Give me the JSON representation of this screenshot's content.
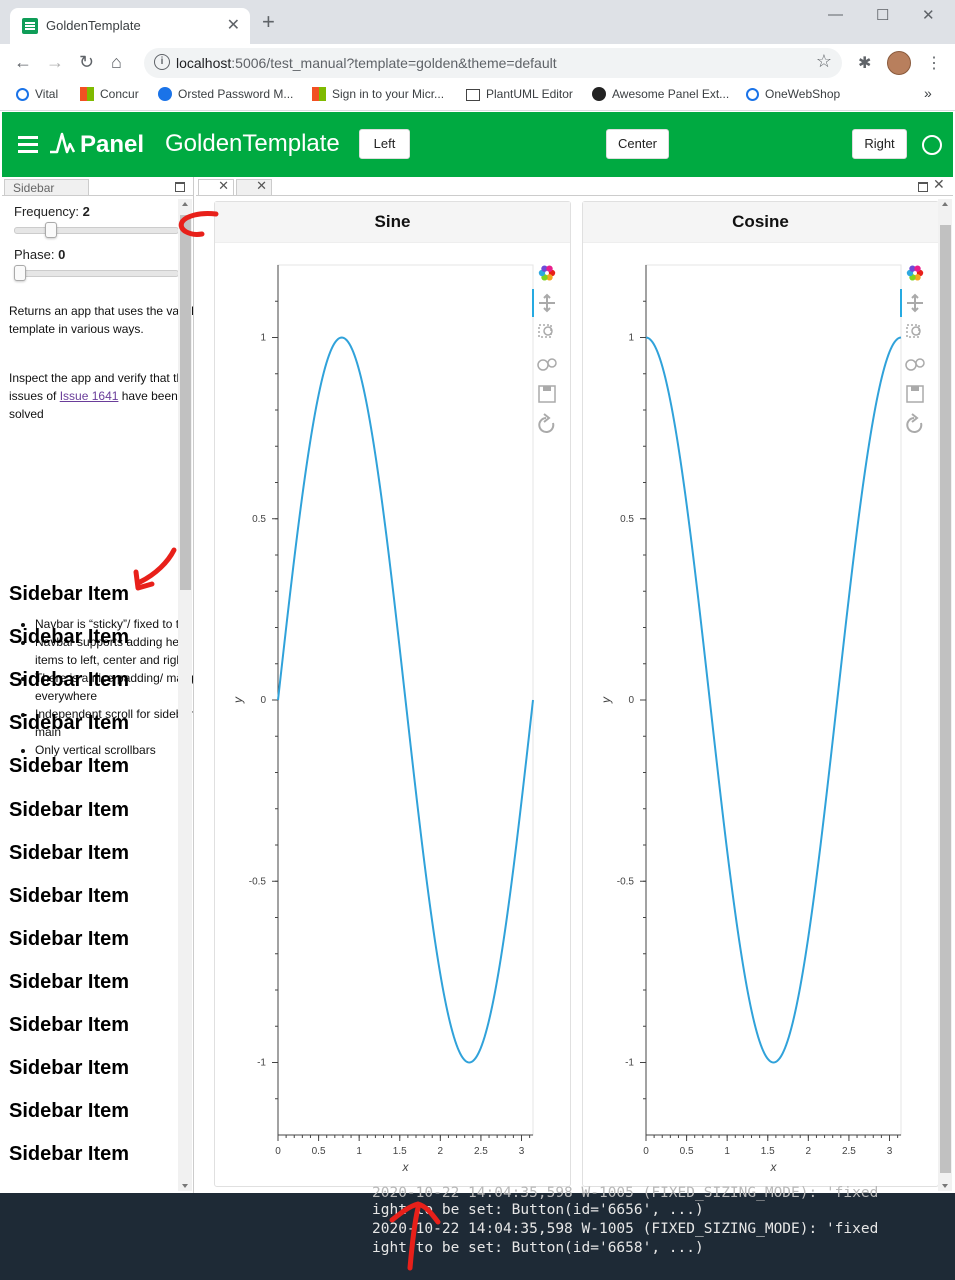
{
  "browser": {
    "tab_title": "GoldenTemplate",
    "url_host": "localhost",
    "url_rest": ":5006/test_manual?template=golden&theme=default",
    "bookmarks": [
      "Vital",
      "Concur",
      "Orsted Password M...",
      "Sign in to your Micr...",
      "PlantUML Editor",
      "Awesome Panel Ext...",
      "OneWebShop"
    ],
    "bookmarks_more": "»"
  },
  "header": {
    "logo": "Panel",
    "title": "GoldenTemplate",
    "left_label": "Left",
    "center_label": "Center",
    "right_label": "Right"
  },
  "sidebar": {
    "tab_label": "Sidebar",
    "frequency_label": "Frequency:",
    "frequency_value": "2",
    "frequency_fraction": 0.2,
    "phase_label": "Phase:",
    "phase_value": "0",
    "phase_fraction": 0.0,
    "desc1": "Returns an app that uses the vanilla template in various ways.",
    "desc2_pre": "Inspect the app and verify that the issues of ",
    "desc2_link": "Issue 1641",
    "desc2_post": " have been solved",
    "bullets": [
      "Navbar is “sticky”/ fixed to the top",
      "Navbar supports adding header items to left, center and right",
      "There is a nice padding/ margin everywhere",
      "Independent scroll for sidebar and main",
      "Only vertical scrollbars"
    ],
    "item_label": "Sidebar Item",
    "item_count": 14
  },
  "chart_data": [
    {
      "type": "line",
      "title": "Sine",
      "xlabel": "x",
      "ylabel": "y",
      "xlim": [
        0,
        3.1416
      ],
      "ylim": [
        -1.2,
        1.2
      ],
      "xticks": [
        "0",
        "0.5",
        "1",
        "1.5",
        "2",
        "2.5",
        "3"
      ],
      "yticks": [
        "-1",
        "-0.5",
        "0",
        "0.5",
        "1"
      ],
      "function": "sin(2x)",
      "color": "#30a2da"
    },
    {
      "type": "line",
      "title": "Cosine",
      "xlabel": "x",
      "ylabel": "y",
      "xlim": [
        0,
        3.1416
      ],
      "ylim": [
        -1.2,
        1.2
      ],
      "xticks": [
        "0",
        "0.5",
        "1",
        "1.5",
        "2",
        "2.5",
        "3"
      ],
      "yticks": [
        "-1",
        "-0.5",
        "0",
        "0.5",
        "1"
      ],
      "function": "cos(2x)",
      "color": "#30a2da"
    }
  ],
  "console": [
    "2020-10-22 14:04:35,598 W-1005 (FIXED_SIZING_MODE): 'fixed",
    "ight to be set: Button(id='6656', ...)",
    "2020-10-22 14:04:35,598 W-1005 (FIXED_SIZING_MODE): 'fixed",
    "ight to be set: Button(id='6658', ...)"
  ],
  "colors": {
    "header": "#00aa41",
    "line": "#30a2da",
    "annotation": "#e8201a"
  }
}
